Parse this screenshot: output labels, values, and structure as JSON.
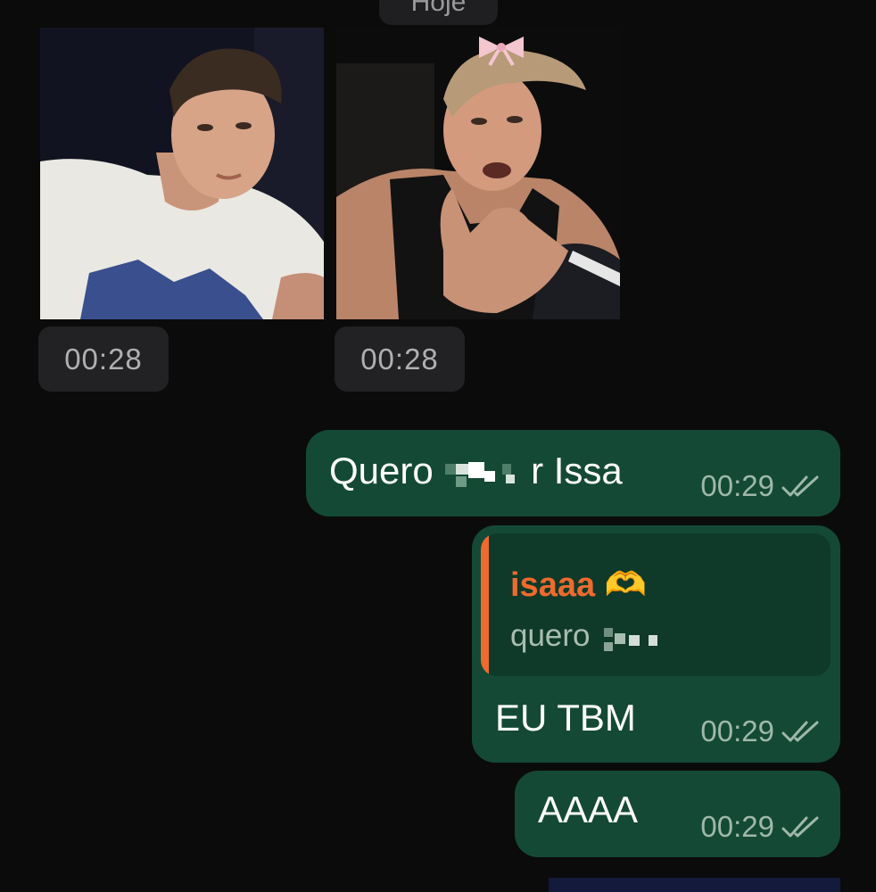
{
  "chat": {
    "date_divider": "Hoje",
    "received": [
      {
        "time": "00:28"
      },
      {
        "time": "00:28"
      }
    ],
    "sent": [
      {
        "text_before": "Quero",
        "text_after": "r Issa",
        "time": "00:29"
      },
      {
        "reply_to": {
          "name": "isaaa 🫶",
          "text": "quero"
        },
        "text": "EU TBM",
        "time": "00:29"
      },
      {
        "text": "AAAA",
        "time": "00:29"
      }
    ]
  },
  "colors": {
    "background": "#0b0b0b",
    "sent_bubble": "#144a35",
    "quote_bg": "#0f3a29",
    "quote_accent": "#ef6a2e",
    "time_chip": "#222224"
  },
  "icons": {
    "read_receipt": "double-check-icon",
    "reaction": "heart-hands-emoji"
  }
}
